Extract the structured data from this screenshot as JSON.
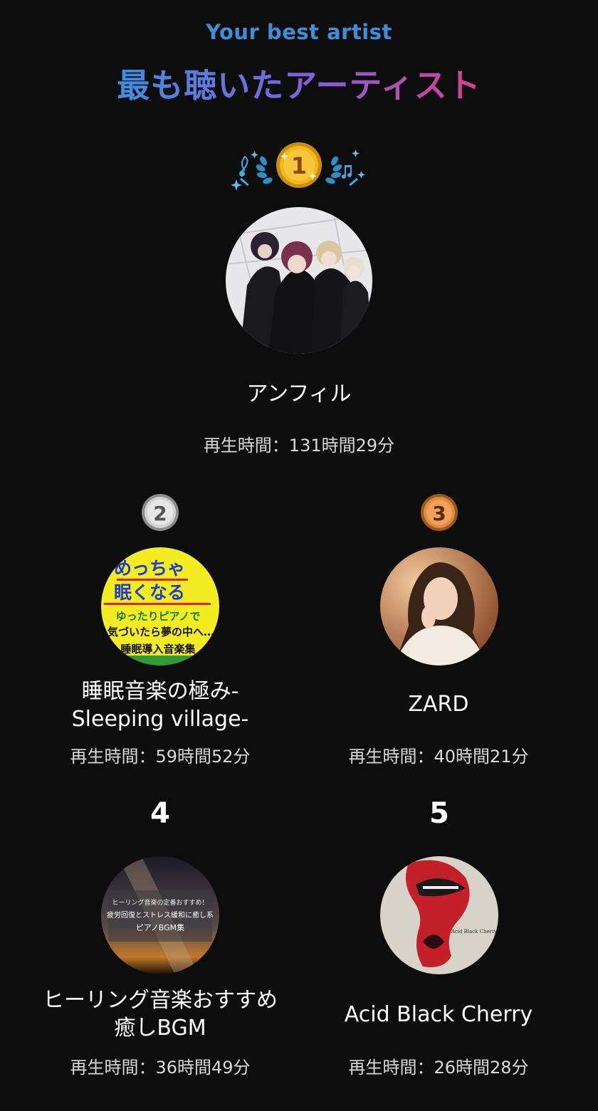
{
  "header": {
    "subtitle": "Your best artist",
    "title": "最も聴いたアーティスト"
  },
  "colors": {
    "background": "#0d0d0d",
    "subtitle": "#3f8fd8",
    "title_gradient": [
      "#3f8fe0",
      "#7d63dd",
      "#d83f8e"
    ],
    "gold": "#f2b820",
    "silver": "#bfbfbf",
    "bronze": "#e08c3c"
  },
  "artists": [
    {
      "rank": "1",
      "name": "アンフィル",
      "playtime": "再生時間：131時間29分",
      "icon": "gold-medal-icon"
    },
    {
      "rank": "2",
      "name": "睡眠音楽の極み-Sleeping village-",
      "playtime": "再生時間：59時間52分",
      "icon": "silver-medal-icon"
    },
    {
      "rank": "3",
      "name": "ZARD",
      "playtime": "再生時間：40時間21分",
      "icon": "bronze-medal-icon"
    },
    {
      "rank": "4",
      "name": "ヒーリング音楽おすすめ癒しBGM",
      "playtime": "再生時間：36時間49分"
    },
    {
      "rank": "5",
      "name": "Acid Black Cherry",
      "playtime": "再生時間：26時間28分"
    }
  ],
  "thumbnails": {
    "sleeping_village_lines": [
      "めっちゃ",
      "眠くなる",
      "ゆったりピアノで",
      "気づいたら夢の中へ…",
      "睡眠導入音楽集"
    ],
    "healing_lines": [
      "ヒーリング音楽の定番おすすめ！",
      "疲労回復とストレス緩和に癒し系",
      "ピアノBGM集"
    ],
    "abc_lines": [
      "Acid Black Cherry"
    ]
  }
}
